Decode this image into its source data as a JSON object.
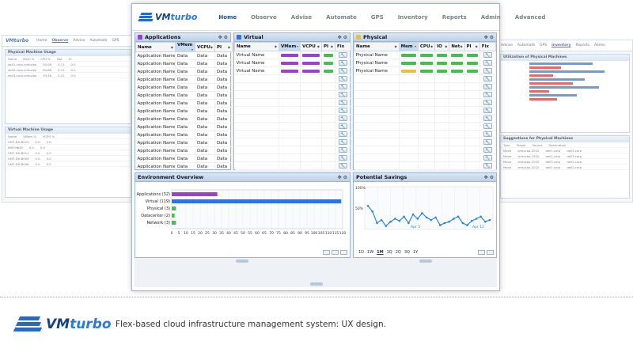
{
  "brand": {
    "logo_vm": "VM",
    "logo_turbo": "turbo"
  },
  "nav": [
    {
      "label": "Home",
      "active": true
    },
    {
      "label": "Observe",
      "active": false
    },
    {
      "label": "Advise",
      "active": false
    },
    {
      "label": "Automate",
      "active": false
    },
    {
      "label": "GPS",
      "active": false
    },
    {
      "label": "Inventory",
      "active": false
    },
    {
      "label": "Reports",
      "active": false
    },
    {
      "label": "Admin",
      "active": false
    },
    {
      "label": "Advanced",
      "active": false
    }
  ],
  "applications": {
    "title": "Applications",
    "columns": [
      "Name",
      "VMem",
      "VCPU",
      "PI",
      "Fix"
    ],
    "rows": [
      {
        "name": "Application Name",
        "vmem": "Data",
        "vcpu": "Data",
        "pi": "Data"
      },
      {
        "name": "Application Name",
        "vmem": "Data",
        "vcpu": "Data",
        "pi": "Data"
      },
      {
        "name": "Application Name",
        "vmem": "Data",
        "vcpu": "Data",
        "pi": "Data"
      },
      {
        "name": "Application Name",
        "vmem": "Data",
        "vcpu": "Data",
        "pi": "Data"
      },
      {
        "name": "Application Name",
        "vmem": "Data",
        "vcpu": "Data",
        "pi": "Data"
      },
      {
        "name": "Application Name",
        "vmem": "Data",
        "vcpu": "Data",
        "pi": "Data"
      },
      {
        "name": "Application Name",
        "vmem": "Data",
        "vcpu": "Data",
        "pi": "Data"
      },
      {
        "name": "Application Name",
        "vmem": "Data",
        "vcpu": "Data",
        "pi": "Data"
      },
      {
        "name": "Application Name",
        "vmem": "Data",
        "vcpu": "Data",
        "pi": "Data"
      },
      {
        "name": "Application Name",
        "vmem": "Data",
        "vcpu": "Data",
        "pi": "Data"
      },
      {
        "name": "Application Name",
        "vmem": "Data",
        "vcpu": "Data",
        "pi": "Data"
      },
      {
        "name": "Application Name",
        "vmem": "Data",
        "vcpu": "Data",
        "pi": "Data"
      },
      {
        "name": "Application Name",
        "vmem": "Data",
        "vcpu": "Data",
        "pi": "Data"
      },
      {
        "name": "Application Name",
        "vmem": "Data",
        "vcpu": "Data",
        "pi": "Data"
      },
      {
        "name": "Application Name",
        "vmem": "Data",
        "vcpu": "Data",
        "pi": "Data"
      }
    ]
  },
  "virtual": {
    "title": "Virtual",
    "columns": [
      "Name",
      "VMem",
      "VCPU",
      "PI",
      "Fix"
    ],
    "rows": [
      {
        "name": "Virtual Name",
        "colors": [
          "#9b3fd6",
          "#9b3fd6",
          "#43c04a"
        ]
      },
      {
        "name": "Virtual Name",
        "colors": [
          "#9b3fd6",
          "#9b3fd6",
          "#43c04a"
        ]
      },
      {
        "name": "Virtual Name",
        "colors": [
          "#9b3fd6",
          "#9b3fd6",
          "#43c04a"
        ]
      }
    ],
    "empty_rows": 12
  },
  "physical": {
    "title": "Physical",
    "columns": [
      "Name",
      "Mem",
      "CPU",
      "IO",
      "Net",
      "PI",
      "Fix"
    ],
    "rows": [
      {
        "name": "Physical Name",
        "colors": [
          "#43c04a",
          "#43c04a",
          "#43c04a",
          "#43c04a",
          "#43c04a"
        ]
      },
      {
        "name": "Physical Name",
        "colors": [
          "#43c04a",
          "#43c04a",
          "#43c04a",
          "#43c04a",
          "#43c04a"
        ]
      },
      {
        "name": "Physical Name",
        "colors": [
          "#e8c13a",
          "#43c04a",
          "#43c04a",
          "#43c04a",
          "#43c04a"
        ]
      }
    ],
    "empty_rows": 12
  },
  "environment": {
    "title": "Environment Overview"
  },
  "savings": {
    "title": "Potential Savings",
    "ranges": [
      "1D",
      "1W",
      "1M",
      "1Q",
      "2Q",
      "3Q",
      "1Y"
    ],
    "selected_range": "1M"
  },
  "caption": "Flex-based cloud infrastructure management system: UX design.",
  "colors": {
    "purple": "#9b3fd6",
    "blue": "#2f74d9",
    "green": "#43c04a",
    "yellow": "#e8c13a",
    "line": "#2f86d0"
  },
  "icons": {
    "fix": "wrench-icon",
    "panel_tools": [
      "move-icon",
      "settings-icon"
    ]
  },
  "chart_data": [
    {
      "type": "bar",
      "orientation": "horizontal",
      "title": "Environment Overview",
      "categories": [
        "Applications (32)",
        "Virtual (119)",
        "Physical (3)",
        "Datacenter (2)",
        "Network (3)"
      ],
      "values": [
        32,
        119,
        3,
        2,
        3
      ],
      "colors": [
        "#9b3fd6",
        "#2f74d9",
        "#43c04a",
        "#43c04a",
        "#43c04a"
      ],
      "xlim": [
        0,
        120
      ],
      "xticks": [
        0,
        5,
        10,
        15,
        20,
        25,
        30,
        35,
        40,
        45,
        50,
        55,
        60,
        65,
        70,
        75,
        80,
        85,
        90,
        95,
        100,
        105,
        110,
        115,
        120
      ],
      "grid": true
    },
    {
      "type": "line",
      "title": "Potential Savings",
      "ylabel_ticks": [
        "100%",
        "50%"
      ],
      "ylim": [
        0,
        100
      ],
      "x_labels": [
        "Apr 5",
        "Apr 12"
      ],
      "values": [
        55,
        42,
        15,
        22,
        8,
        18,
        25,
        20,
        30,
        15,
        35,
        25,
        38,
        28,
        22,
        28,
        10,
        15,
        18,
        25,
        30,
        15,
        10,
        20,
        25,
        30,
        18,
        22
      ],
      "grid": true
    }
  ]
}
